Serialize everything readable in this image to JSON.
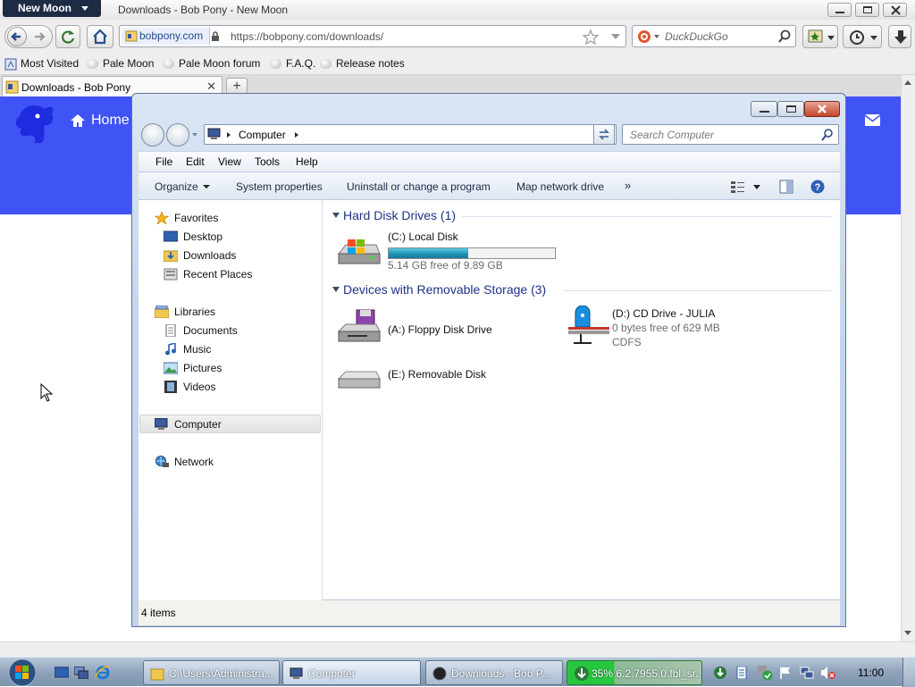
{
  "browser": {
    "app_menu": "New Moon",
    "window_title": "Downloads - Bob Pony - New Moon",
    "site_identity": "bobpony.com",
    "url": "https://bobpony.com/downloads/",
    "search_placeholder": "DuckDuckGo",
    "bookmarks": [
      "Most Visited",
      "Pale Moon",
      "Pale Moon forum",
      "F.A.Q.",
      "Release notes"
    ],
    "tab_title": "Downloads - Bob Pony"
  },
  "page": {
    "home_link": "Home",
    "accent_color": "#4054f5"
  },
  "explorer": {
    "breadcrumb": "Computer",
    "search_placeholder": "Search Computer",
    "menu": [
      "File",
      "Edit",
      "View",
      "Tools",
      "Help"
    ],
    "commands": [
      "Organize",
      "System properties",
      "Uninstall or change a program",
      "Map network drive"
    ],
    "nav": {
      "favorites": "Favorites",
      "desktop": "Desktop",
      "downloads": "Downloads",
      "recent_places": "Recent Places",
      "libraries": "Libraries",
      "documents": "Documents",
      "music": "Music",
      "pictures": "Pictures",
      "videos": "Videos",
      "computer": "Computer",
      "network": "Network"
    },
    "groups": {
      "hard_disk": "Hard Disk Drives (1)",
      "removable": "Devices with Removable Storage (3)"
    },
    "drives": {
      "c_name": "(C:) Local Disk",
      "c_free": "5.14 GB free of 9.89 GB",
      "c_used_fraction": 0.48,
      "a_name": "(A:) Floppy Disk Drive",
      "d_name": "(D:) CD Drive - JULIA",
      "d_free": "0 bytes free of 629 MB",
      "d_fs": "CDFS",
      "e_name": "(E:) Removable Disk"
    },
    "status": "4 items"
  },
  "taskbar": {
    "items": [
      "C:\\Users\\Administra...",
      "Computer",
      "Downloads - Bob P...",
      "35% 6.2.7955.0.fbl_sr..."
    ],
    "download_progress": 0.35,
    "clock": "11:00"
  }
}
